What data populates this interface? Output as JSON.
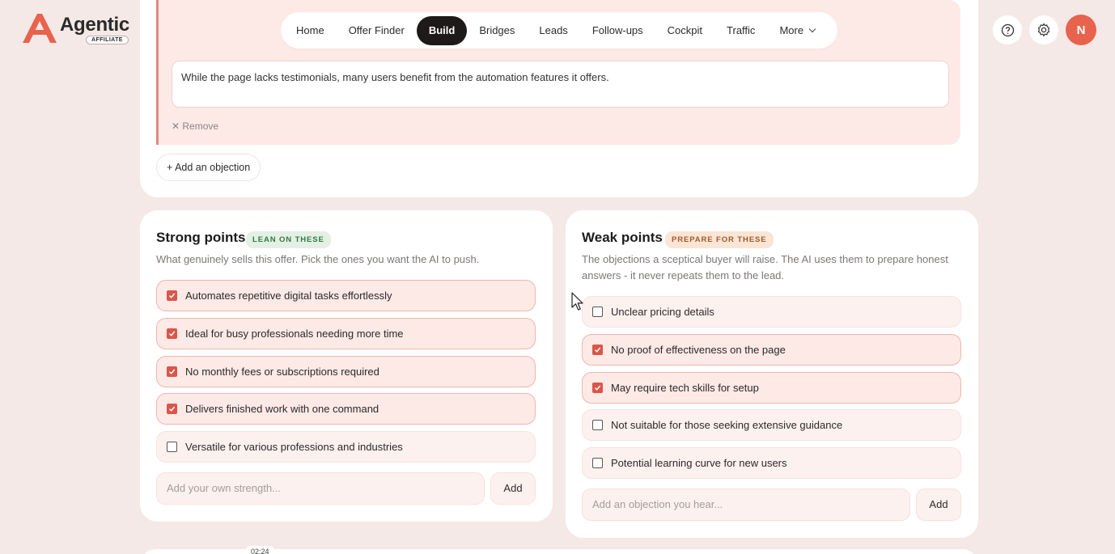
{
  "brand": {
    "name": "Agentic",
    "badge": "AFFILIATE",
    "accent": "#e8634d"
  },
  "nav": {
    "items": [
      {
        "label": "Home",
        "active": false
      },
      {
        "label": "Offer Finder",
        "active": false
      },
      {
        "label": "Build",
        "active": true
      },
      {
        "label": "Bridges",
        "active": false
      },
      {
        "label": "Leads",
        "active": false
      },
      {
        "label": "Follow-ups",
        "active": false
      },
      {
        "label": "Cockpit",
        "active": false
      },
      {
        "label": "Traffic",
        "active": false
      }
    ],
    "more_label": "More"
  },
  "header_actions": {
    "help_icon": "help-circle-icon",
    "settings_icon": "gear-icon",
    "avatar_initial": "N"
  },
  "objection_card": {
    "objection_text": "While the page lacks testimonials, many users benefit from the automation features it offers.",
    "remove_label": "Remove",
    "add_button_label": "+ Add an objection"
  },
  "strong_points": {
    "title": "Strong points",
    "tag": "LEAN ON THESE",
    "description": "What genuinely sells this offer. Pick the ones you want the AI to push.",
    "items": [
      {
        "label": "Automates repetitive digital tasks effortlessly",
        "checked": true
      },
      {
        "label": "Ideal for busy professionals needing more time",
        "checked": true
      },
      {
        "label": "No monthly fees or subscriptions required",
        "checked": true
      },
      {
        "label": "Delivers finished work with one command",
        "checked": true
      },
      {
        "label": "Versatile for various professions and industries",
        "checked": false
      }
    ],
    "input_placeholder": "Add your own strength...",
    "add_label": "Add"
  },
  "weak_points": {
    "title": "Weak points",
    "tag": "PREPARE FOR THESE",
    "description_line1": "The objections a sceptical buyer will raise. The AI uses them to prepare honest",
    "description_line2": "answers - it never repeats them to the lead.",
    "items": [
      {
        "label": "Unclear pricing details",
        "checked": false
      },
      {
        "label": "No proof of effectiveness on the page",
        "checked": true
      },
      {
        "label": "May require tech skills for setup",
        "checked": true
      },
      {
        "label": "Not suitable for those seeking extensive guidance",
        "checked": false
      },
      {
        "label": "Potential learning curve for new users",
        "checked": false
      }
    ],
    "input_placeholder": "Add an objection you hear...",
    "add_label": "Add"
  },
  "timestamp": "02:24"
}
